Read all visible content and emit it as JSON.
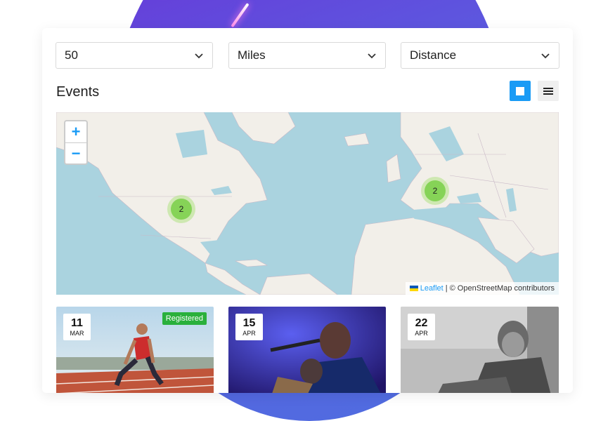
{
  "filters": {
    "radius": "50",
    "unit": "Miles",
    "sort": "Distance"
  },
  "section": {
    "title": "Events"
  },
  "map": {
    "zoom_in": "+",
    "zoom_out": "−",
    "clusters": [
      {
        "label": "2",
        "region": "north-america"
      },
      {
        "label": "2",
        "region": "europe"
      }
    ],
    "attribution_link": "Leaflet",
    "attribution_text": "| © OpenStreetMap contributors"
  },
  "events": [
    {
      "day": "11",
      "month": "MAR",
      "badge": "Registered",
      "image": "sprinter-on-track"
    },
    {
      "day": "15",
      "month": "APR",
      "badge": "",
      "image": "singer-on-stage"
    },
    {
      "day": "22",
      "month": "APR",
      "badge": "",
      "image": "elderly-man-bw"
    }
  ],
  "colors": {
    "accent": "#1a9bf5",
    "registered": "#2ab03c",
    "water": "#aad3df",
    "land": "#f2efe9"
  }
}
